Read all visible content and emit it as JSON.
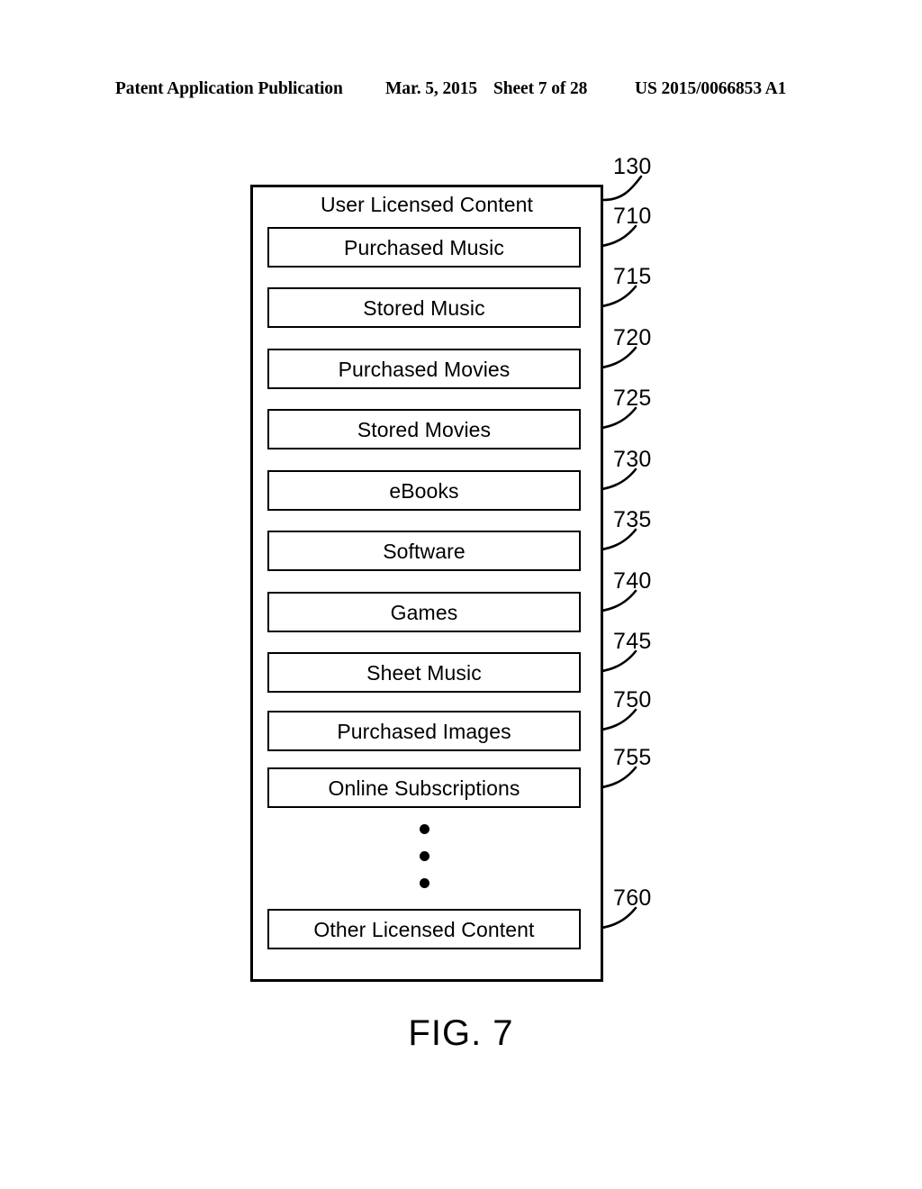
{
  "header": {
    "title": "Patent Application Publication",
    "date": "Mar. 5, 2015",
    "sheet": "Sheet 7 of 28",
    "doc_number": "US 2015/0066853 A1"
  },
  "figure": {
    "caption": "FIG. 7",
    "container": {
      "title": "User Licensed Content",
      "ref": "130"
    },
    "ellipsis_symbol": "vertical-ellipsis",
    "items": [
      {
        "label": "Purchased Music",
        "ref": "710"
      },
      {
        "label": "Stored Music",
        "ref": "715"
      },
      {
        "label": "Purchased Movies",
        "ref": "720"
      },
      {
        "label": "Stored Movies",
        "ref": "725"
      },
      {
        "label": "eBooks",
        "ref": "730"
      },
      {
        "label": "Software",
        "ref": "735"
      },
      {
        "label": "Games",
        "ref": "740"
      },
      {
        "label": "Sheet Music",
        "ref": "745"
      },
      {
        "label": "Purchased Images",
        "ref": "750"
      },
      {
        "label": "Online Subscriptions",
        "ref": "755"
      },
      {
        "label": "Other Licensed Content",
        "ref": "760"
      }
    ]
  },
  "colors": {
    "ink": "#000000",
    "paper": "#ffffff"
  }
}
